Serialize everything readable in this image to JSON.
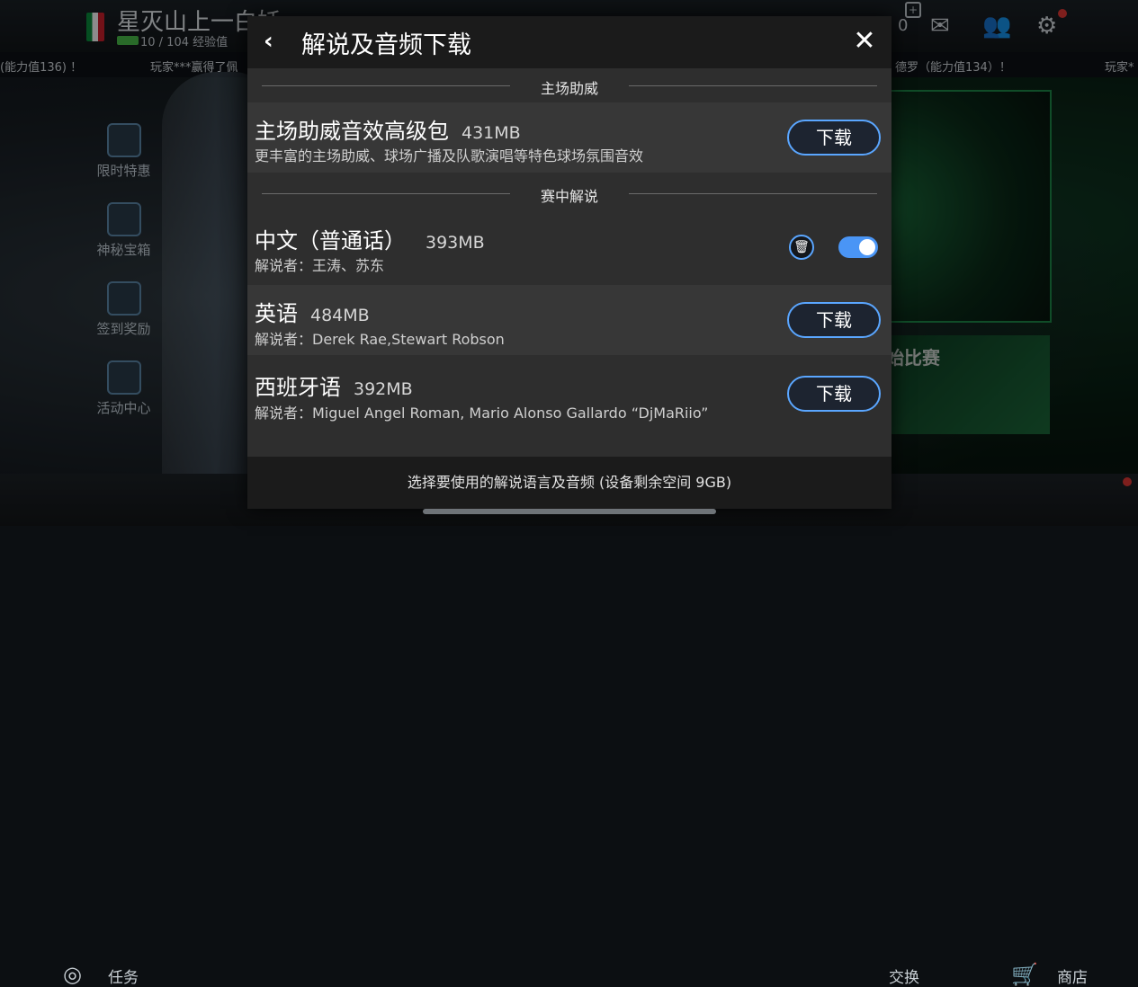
{
  "background": {
    "player_name": "星灭山上一白妖",
    "xp_text": "10 / 104 经验值",
    "top_counter": "0",
    "ticker": [
      "(能力值136) ！",
      "玩家***赢得了佩",
      "德罗（能力值134）！",
      "玩家*"
    ],
    "side_menu": [
      {
        "label": "限时特惠",
        "icon": "ball-icon"
      },
      {
        "label": "神秘宝箱",
        "icon": "chest-icon"
      },
      {
        "label": "签到奖励",
        "icon": "calendar-icon"
      },
      {
        "label": "活动中心",
        "icon": "gift-icon"
      }
    ],
    "right_card_text": "始比赛",
    "bottom_bar": {
      "tasks_label": "任务",
      "exchange_label": "交换",
      "shop_label": "商店"
    }
  },
  "dialog": {
    "title": "解说及音频下载",
    "sections": {
      "home": "主场助威",
      "commentary": "赛中解说"
    },
    "home_pack": {
      "name": "主场助威音效高级包",
      "size": "431MB",
      "description": "更丰富的主场助威、球场广播及队歌演唱等特色球场氛围音效",
      "button": "下载"
    },
    "languages": [
      {
        "name": "中文（普通话）",
        "size": "393MB",
        "commentators": "解说者：王涛、苏东",
        "installed": true,
        "enabled": true
      },
      {
        "name": "英语",
        "size": "484MB",
        "commentators": "解说者：Derek Rae,Stewart Robson",
        "button": "下载"
      },
      {
        "name": "西班牙语",
        "size": "392MB",
        "commentators": "解说者：Miguel Angel Roman, Mario Alonso Gallardo “DjMaRiio”",
        "button": "下载"
      }
    ],
    "footer": "选择要使用的解说语言及音频 (设备剩余空间 9GB)"
  },
  "colors": {
    "accent_blue": "#5aa6ff",
    "toggle_on": "#4a95f5",
    "dialog_bg": "#2e2e2e",
    "header_bg": "#1b1b1b"
  }
}
